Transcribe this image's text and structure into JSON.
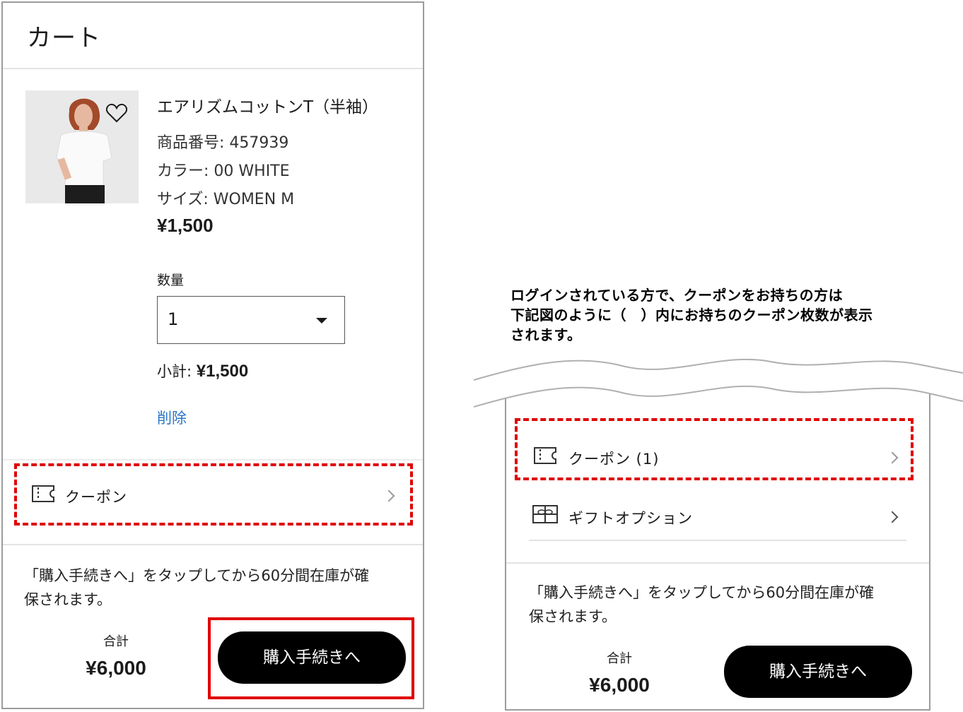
{
  "left": {
    "title": "カート",
    "product": {
      "name": "エアリズムコットンT（半袖）",
      "number": "商品番号: 457939",
      "color": "カラー: 00 WHITE",
      "size": "サイズ: WOMEN M",
      "price": "¥1,500"
    },
    "qty_label": "数量",
    "qty_value": "1",
    "subtotal_label": "小計:",
    "subtotal_value": "¥1,500",
    "delete": "削除",
    "coupon": "クーポン",
    "note": [
      "「購入手続きへ」をタップしてから60分間在庫が確",
      "保されます。"
    ],
    "total_label": "合計",
    "total_value": "¥6,000",
    "checkout": "購入手続きへ"
  },
  "caption": [
    "ログインされている方で、クーポンをお持ちの方は",
    "下記図のように（　）内にお持ちのクーポン枚数が表示",
    "されます。"
  ],
  "right": {
    "coupon": "クーポン (1)",
    "gift": "ギフトオプション",
    "note": [
      "「購入手続きへ」をタップしてから60分間在庫が確",
      "保されます。"
    ],
    "total_label": "合計",
    "total_value": "¥6,000",
    "checkout": "購入手続きへ"
  },
  "colors": {
    "highlight": "#e00000",
    "link": "#2a74c6",
    "button": "#000000"
  },
  "icons": [
    "heart-icon",
    "ticket-icon",
    "gift-icon",
    "chevron-right-icon",
    "dropdown-arrow-icon"
  ]
}
